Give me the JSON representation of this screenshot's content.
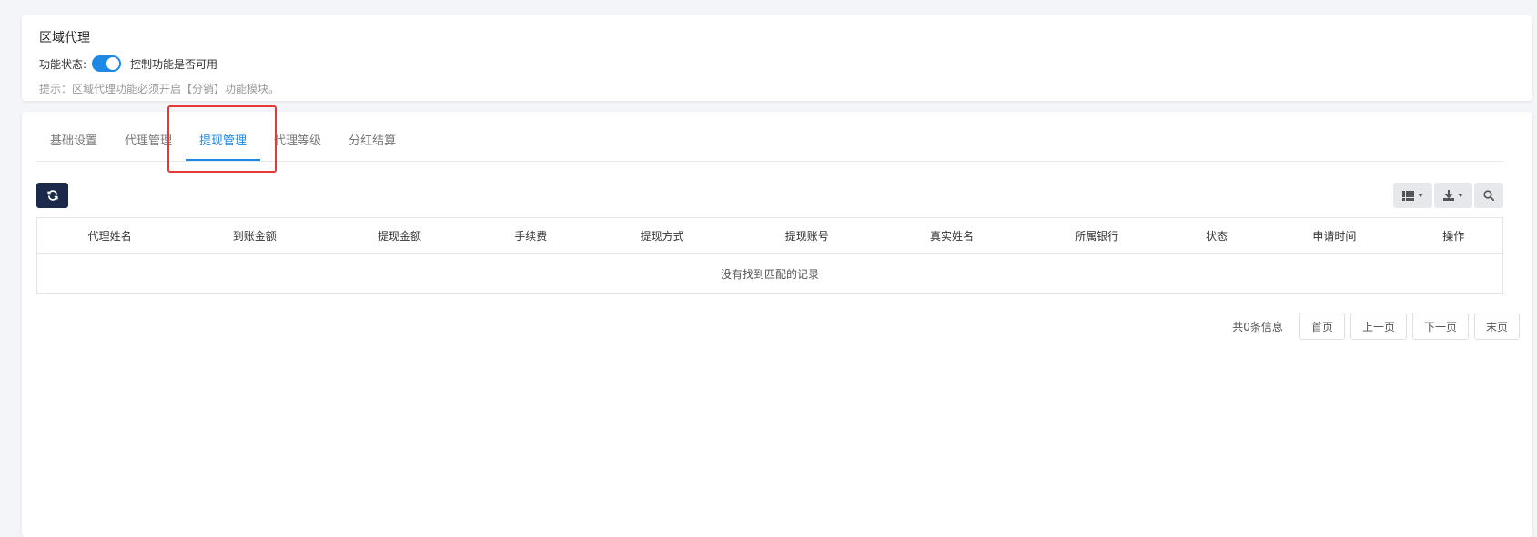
{
  "module": {
    "title": "区域代理",
    "status_label": "功能状态:",
    "toggle_on": true,
    "status_desc": "控制功能是否可用",
    "hint": "提示：区域代理功能必须开启【分销】功能模块。"
  },
  "tabs": [
    {
      "label": "基础设置",
      "active": false
    },
    {
      "label": "代理管理",
      "active": false
    },
    {
      "label": "提现管理",
      "active": true
    },
    {
      "label": "代理等级",
      "active": false
    },
    {
      "label": "分红结算",
      "active": false
    }
  ],
  "table": {
    "columns": [
      "代理姓名",
      "到账金额",
      "提现金额",
      "手续费",
      "提现方式",
      "提现账号",
      "真实姓名",
      "所属银行",
      "状态",
      "申请时间",
      "操作"
    ],
    "empty_text": "没有找到匹配的记录"
  },
  "pagination": {
    "total": "共0条信息",
    "first": "首页",
    "prev": "上一页",
    "next": "下一页",
    "last": "末页"
  },
  "colors": {
    "accent": "#1e88e5",
    "highlight": "#e53935",
    "refresh_bg": "#1b2a4a"
  },
  "icons": {
    "refresh": "refresh-icon",
    "columns": "columns-icon",
    "export": "download-icon",
    "search": "search-icon"
  }
}
